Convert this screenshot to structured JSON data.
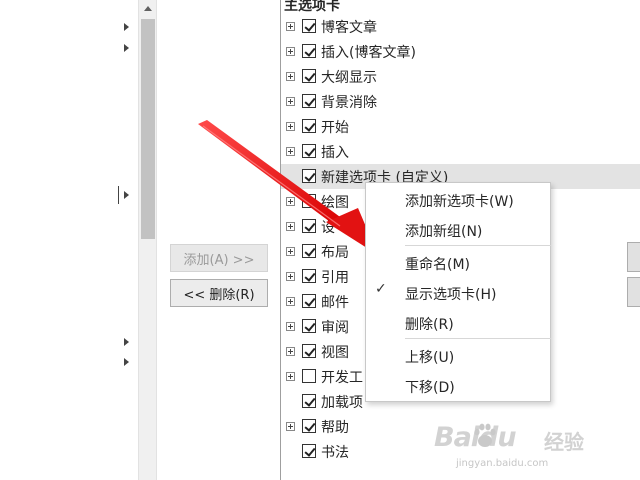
{
  "left": {
    "add_button": "添加(A) >>",
    "remove_button": "<< 删除(R)"
  },
  "tree": {
    "header": "主选项卡",
    "items": [
      {
        "label": "博客文章",
        "expandable": true,
        "checked": true
      },
      {
        "label": "插入(博客文章)",
        "expandable": true,
        "checked": true
      },
      {
        "label": "大纲显示",
        "expandable": true,
        "checked": true
      },
      {
        "label": "背景消除",
        "expandable": true,
        "checked": true
      },
      {
        "label": "开始",
        "expandable": true,
        "checked": true
      },
      {
        "label": "插入",
        "expandable": true,
        "checked": true
      },
      {
        "label": "新建选项卡 (自定义)",
        "expandable": false,
        "checked": true,
        "selected": true
      },
      {
        "label": "绘图",
        "expandable": true,
        "checked": false
      },
      {
        "label": "设",
        "expandable": true,
        "checked": true
      },
      {
        "label": "布局",
        "expandable": true,
        "checked": true
      },
      {
        "label": "引用",
        "expandable": true,
        "checked": true
      },
      {
        "label": "邮件",
        "expandable": true,
        "checked": true
      },
      {
        "label": "审阅",
        "expandable": true,
        "checked": true
      },
      {
        "label": "视图",
        "expandable": true,
        "checked": true
      },
      {
        "label": "开发工",
        "expandable": true,
        "checked": false
      },
      {
        "label": "加载项",
        "expandable": false,
        "checked": true
      },
      {
        "label": "帮助",
        "expandable": true,
        "checked": true
      },
      {
        "label": "书法",
        "expandable": false,
        "checked": true
      }
    ]
  },
  "context_menu": {
    "add_tab": "添加新选项卡(W)",
    "add_group": "添加新组(N)",
    "rename": "重命名(M)",
    "show_tab": "显示选项卡(H)",
    "show_tab_checked": true,
    "remove": "删除(R)",
    "move_up": "上移(U)",
    "move_down": "下移(D)"
  },
  "watermark": {
    "brand_latin": "Baidu",
    "brand_cn": "经验",
    "url": "jingyan.baidu.com"
  },
  "icons": {
    "check": "✓",
    "expander": "plus-box-icon",
    "arrow": "red-annotation-arrow"
  },
  "colors": {
    "arrow_red": "#e81010",
    "selected_row": "#e3e3e3"
  }
}
